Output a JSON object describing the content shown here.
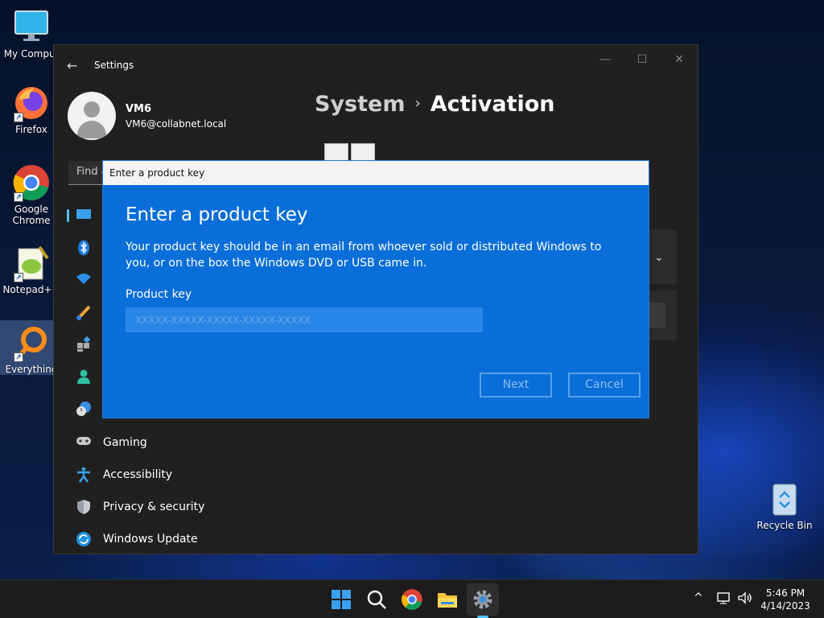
{
  "desktop": {
    "icons": [
      {
        "label": "My Comput"
      },
      {
        "label": "Firefox"
      },
      {
        "label": "Google Chrome"
      },
      {
        "label": "Notepad++"
      },
      {
        "label": "Everything"
      }
    ],
    "recycle_bin": "Recycle Bin"
  },
  "settings": {
    "title": "Settings",
    "user": {
      "name": "VM6",
      "email": "VM6@collabnet.local"
    },
    "find_placeholder": "Find a",
    "breadcrumb": {
      "parent": "System",
      "separator": "›",
      "current": "Activation"
    },
    "nav": [
      {
        "label": "",
        "icon": "system-icon"
      },
      {
        "label": "",
        "icon": "bluetooth-icon"
      },
      {
        "label": "",
        "icon": "wifi-icon"
      },
      {
        "label": "",
        "icon": "personalization-icon"
      },
      {
        "label": "",
        "icon": "apps-icon"
      },
      {
        "label": "",
        "icon": "accounts-icon"
      },
      {
        "label": "",
        "icon": "time-language-icon"
      },
      {
        "label": "Gaming",
        "icon": "gaming-icon"
      },
      {
        "label": "Accessibility",
        "icon": "accessibility-icon"
      },
      {
        "label": "Privacy & security",
        "icon": "shield-icon"
      },
      {
        "label": "Windows Update",
        "icon": "update-icon"
      }
    ]
  },
  "dialog": {
    "window_title": "Enter a product key",
    "heading": "Enter a product key",
    "description": "Your product key should be in an email from whoever sold or distributed Windows to you, or on the box the Windows DVD or USB came in.",
    "field_label": "Product key",
    "field_value": "",
    "field_placeholder": "XXXXX-XXXXX-XXXXX-XXXXX-XXXXX",
    "next_label": "Next",
    "cancel_label": "Cancel"
  },
  "taskbar": {
    "time": "5:46 PM",
    "date": "4/14/2023",
    "tray_chevron": "^"
  },
  "colors": {
    "dialog_blue": "#0a6ed8",
    "accent": "#4cc2ff",
    "window_bg": "#202020"
  }
}
